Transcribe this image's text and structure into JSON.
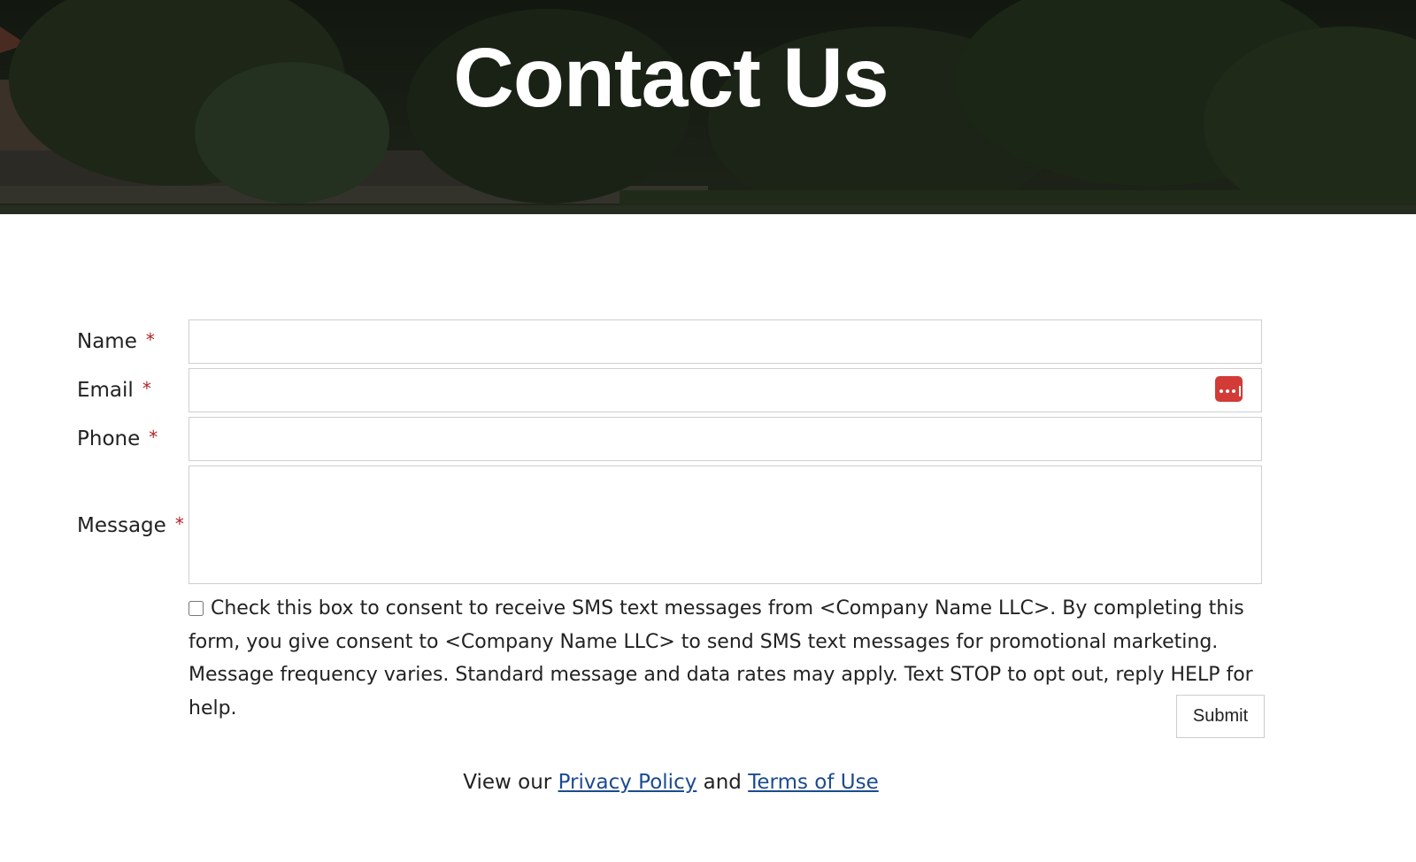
{
  "hero": {
    "title": "Contact Us"
  },
  "form": {
    "required_mark": "*",
    "name": {
      "label": "Name",
      "value": ""
    },
    "email": {
      "label": "Email",
      "value": ""
    },
    "phone": {
      "label": "Phone",
      "value": ""
    },
    "message": {
      "label": "Message",
      "value": ""
    },
    "consent": {
      "checked": false,
      "text": "Check this box to consent to receive SMS text messages from <Company Name LLC>. By completing this form, you give consent to <Company Name LLC> to send SMS text messages for promotional marketing. Message frequency varies. Standard message and data rates may apply. Text STOP to opt out, reply HELP for help."
    },
    "submit_label": "Submit"
  },
  "footer": {
    "prefix": "View our",
    "privacy_link": "Privacy Policy",
    "connector": "and",
    "terms_link": "Terms of Use"
  },
  "colors": {
    "required": "#b0252a",
    "link": "#1c4b8f",
    "password_manager_icon": "#d23b36"
  },
  "icons": {
    "email_field_icon": "password-manager-icon"
  }
}
